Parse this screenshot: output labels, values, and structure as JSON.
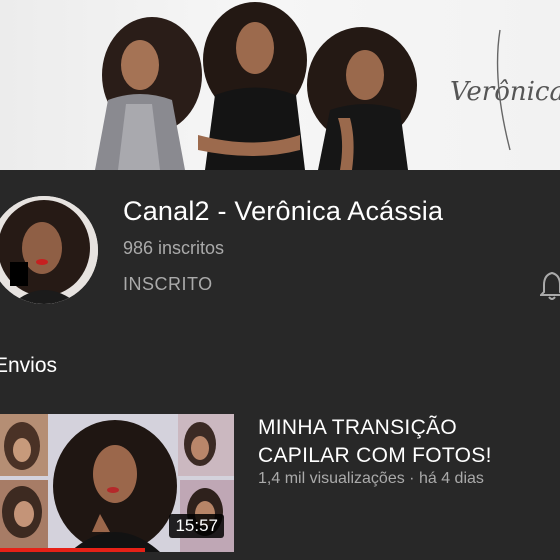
{
  "banner": {
    "signature": "Verônica"
  },
  "channel": {
    "name": "Canal2 - Verônica Acássia",
    "subscribers": "986 inscritos",
    "subscribe_state": "INSCRITO"
  },
  "uploads": {
    "section_title": "Envios",
    "videos": [
      {
        "title": "MINHA TRANSIÇÃO CAPILAR COM FOTOS!",
        "views": "1,4 mil visualizações",
        "separator": " · ",
        "age": "há 4 dias",
        "duration": "15:57",
        "watched_fraction": 0.62
      }
    ]
  },
  "colors": {
    "background": "#282828",
    "secondary_text": "#aaaaaa",
    "progress_red": "#e62117"
  }
}
